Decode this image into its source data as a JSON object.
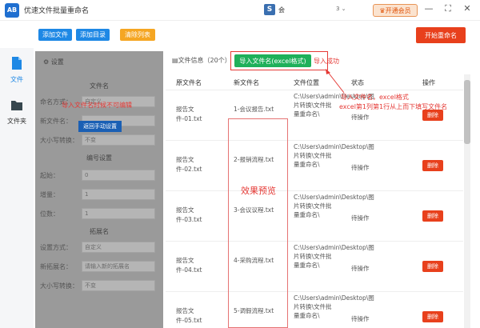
{
  "titlebar": {
    "logo_text": "AB",
    "title": "优速文件批量重命名",
    "user_logo": "S",
    "user_name": "会",
    "version_text": "3 ⌄",
    "vip_label": "开通会员",
    "min": "—",
    "max": "⛶",
    "close": "✕"
  },
  "toolbar": {
    "add_file": "添加文件",
    "add_dir": "添加目录",
    "clear_list": "清除列表",
    "start": "开始重命名"
  },
  "sidebar": {
    "file_label": "文件",
    "folder_label": "文件夹"
  },
  "settings": {
    "title": "设置",
    "section_filename": "文件名",
    "naming_mode_label": "命名方式：",
    "naming_mode_value": "自定义",
    "new_name_label": "新文件名：",
    "case_label": "大小写转换：",
    "case_value": "不变",
    "section_number": "编号设置",
    "start_label": "起始：",
    "start_value": "0",
    "incr_label": "增量：",
    "incr_value": "1",
    "digits_label": "位数：",
    "digits_value": "1",
    "section_ext": "拓展名",
    "ext_mode_label": "设置方式：",
    "ext_mode_value": "自定义",
    "new_ext_label": "新拓展名：",
    "new_ext_value": "请输入新的拓展名",
    "ext_case_label": "大小写转换：",
    "ext_case_value": "不变",
    "return_btn": "返回手动设置",
    "disabled_note": "导入文件名时候不可编辑"
  },
  "main": {
    "file_info": "文件信息（20个）",
    "import_btn": "导入文件名(excel格式)",
    "import_ok": "导入成功",
    "columns": [
      "原文件名",
      "新文件名",
      "文件位置",
      "状态",
      "操作"
    ],
    "rows": [
      {
        "orig": "报告文件-01.txt",
        "newname": "1-会议报告.txt",
        "path": "C:\\Users\\admin\\Desktop\\图片转换\\文件批量重命名\\",
        "status": "待操作",
        "action": "删除"
      },
      {
        "orig": "报告文件-02.txt",
        "newname": "2-报销流程.txt",
        "path": "C:\\Users\\admin\\Desktop\\图片转换\\文件批量重命名\\",
        "status": "待操作",
        "action": "删除"
      },
      {
        "orig": "报告文件-03.txt",
        "newname": "3-会议议程.txt",
        "path": "C:\\Users\\admin\\Desktop\\图片转换\\文件批量重命名\\",
        "status": "待操作",
        "action": "删除"
      },
      {
        "orig": "报告文件-04.txt",
        "newname": "4-采购流程.txt",
        "path": "C:\\Users\\admin\\Desktop\\图片转换\\文件批量重命名\\",
        "status": "待操作",
        "action": "删除"
      },
      {
        "orig": "报告文件-05.txt",
        "newname": "5-调假流程.txt",
        "path": "C:\\Users\\admin\\Desktop\\图片转换\\文件批量重命名\\",
        "status": "待操作",
        "action": "删除"
      }
    ],
    "preview_label": "效果预览",
    "anno_line1": "导入文件名，excel格式",
    "anno_line2": "excel第1列第1行从上而下填写文件名"
  }
}
